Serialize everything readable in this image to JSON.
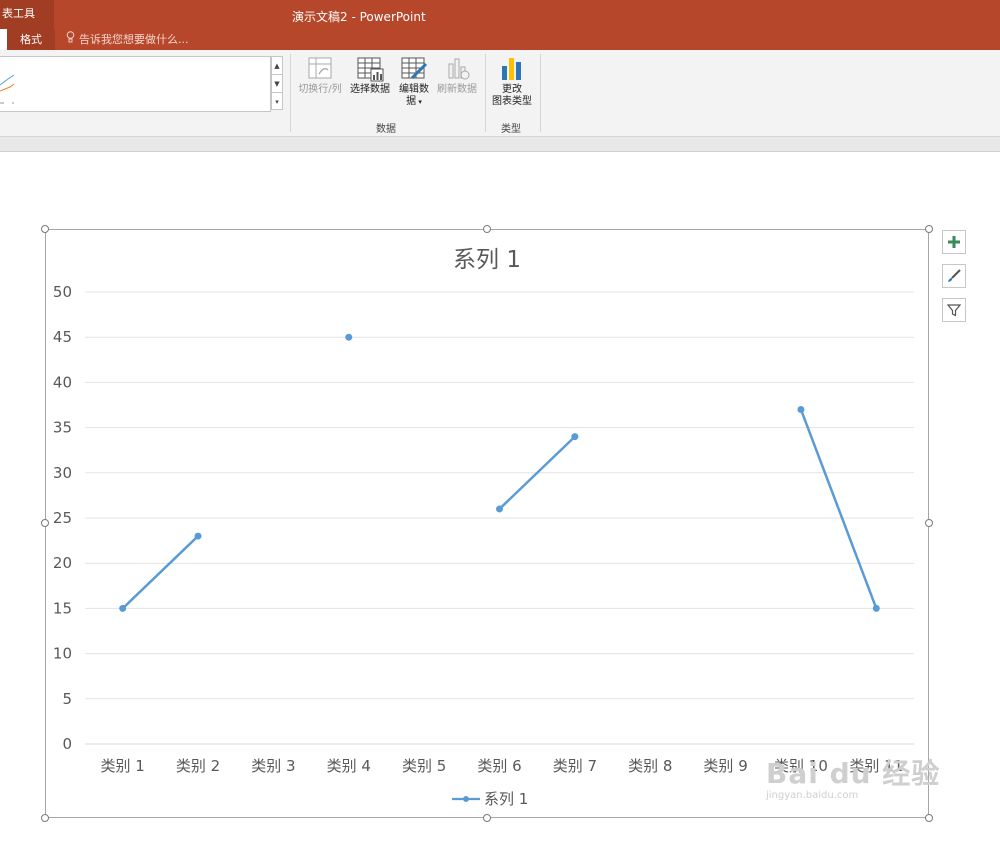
{
  "titlebar": {
    "context_group": "表工具",
    "window_title": "演示文稿2 - PowerPoint",
    "tab_format": "格式",
    "tell_me": "告诉我您想要做什么..."
  },
  "ribbon": {
    "buttons": {
      "switch_row_col": "切换行/列",
      "select_data": "选择数据",
      "edit_data_1": "编辑数",
      "edit_data_2": "据",
      "refresh_data": "刷新数据",
      "change_type_1": "更改",
      "change_type_2": "图表类型"
    },
    "groups": {
      "data": "数据",
      "type": "类型"
    }
  },
  "chart_data": {
    "type": "line",
    "title": "系列 1",
    "categories": [
      "类别 1",
      "类别 2",
      "类别 3",
      "类别 4",
      "类别 5",
      "类别 6",
      "类别 7",
      "类别 8",
      "类别 9",
      "类别 10",
      "类别 11"
    ],
    "series": [
      {
        "name": "系列 1",
        "values": [
          15,
          23,
          null,
          45,
          null,
          26,
          34,
          null,
          null,
          37,
          15
        ],
        "color": "#5b9bd5"
      }
    ],
    "ylim": [
      0,
      50
    ],
    "yticks": [
      0,
      5,
      10,
      15,
      20,
      25,
      30,
      35,
      40,
      45,
      50
    ],
    "grid": true,
    "legend": "bottom"
  },
  "watermark": {
    "brand": "Bai du 经验",
    "url": "jingyan.baidu.com"
  },
  "colors": {
    "accent": "#b7472a",
    "series": "#5b9bd5"
  }
}
